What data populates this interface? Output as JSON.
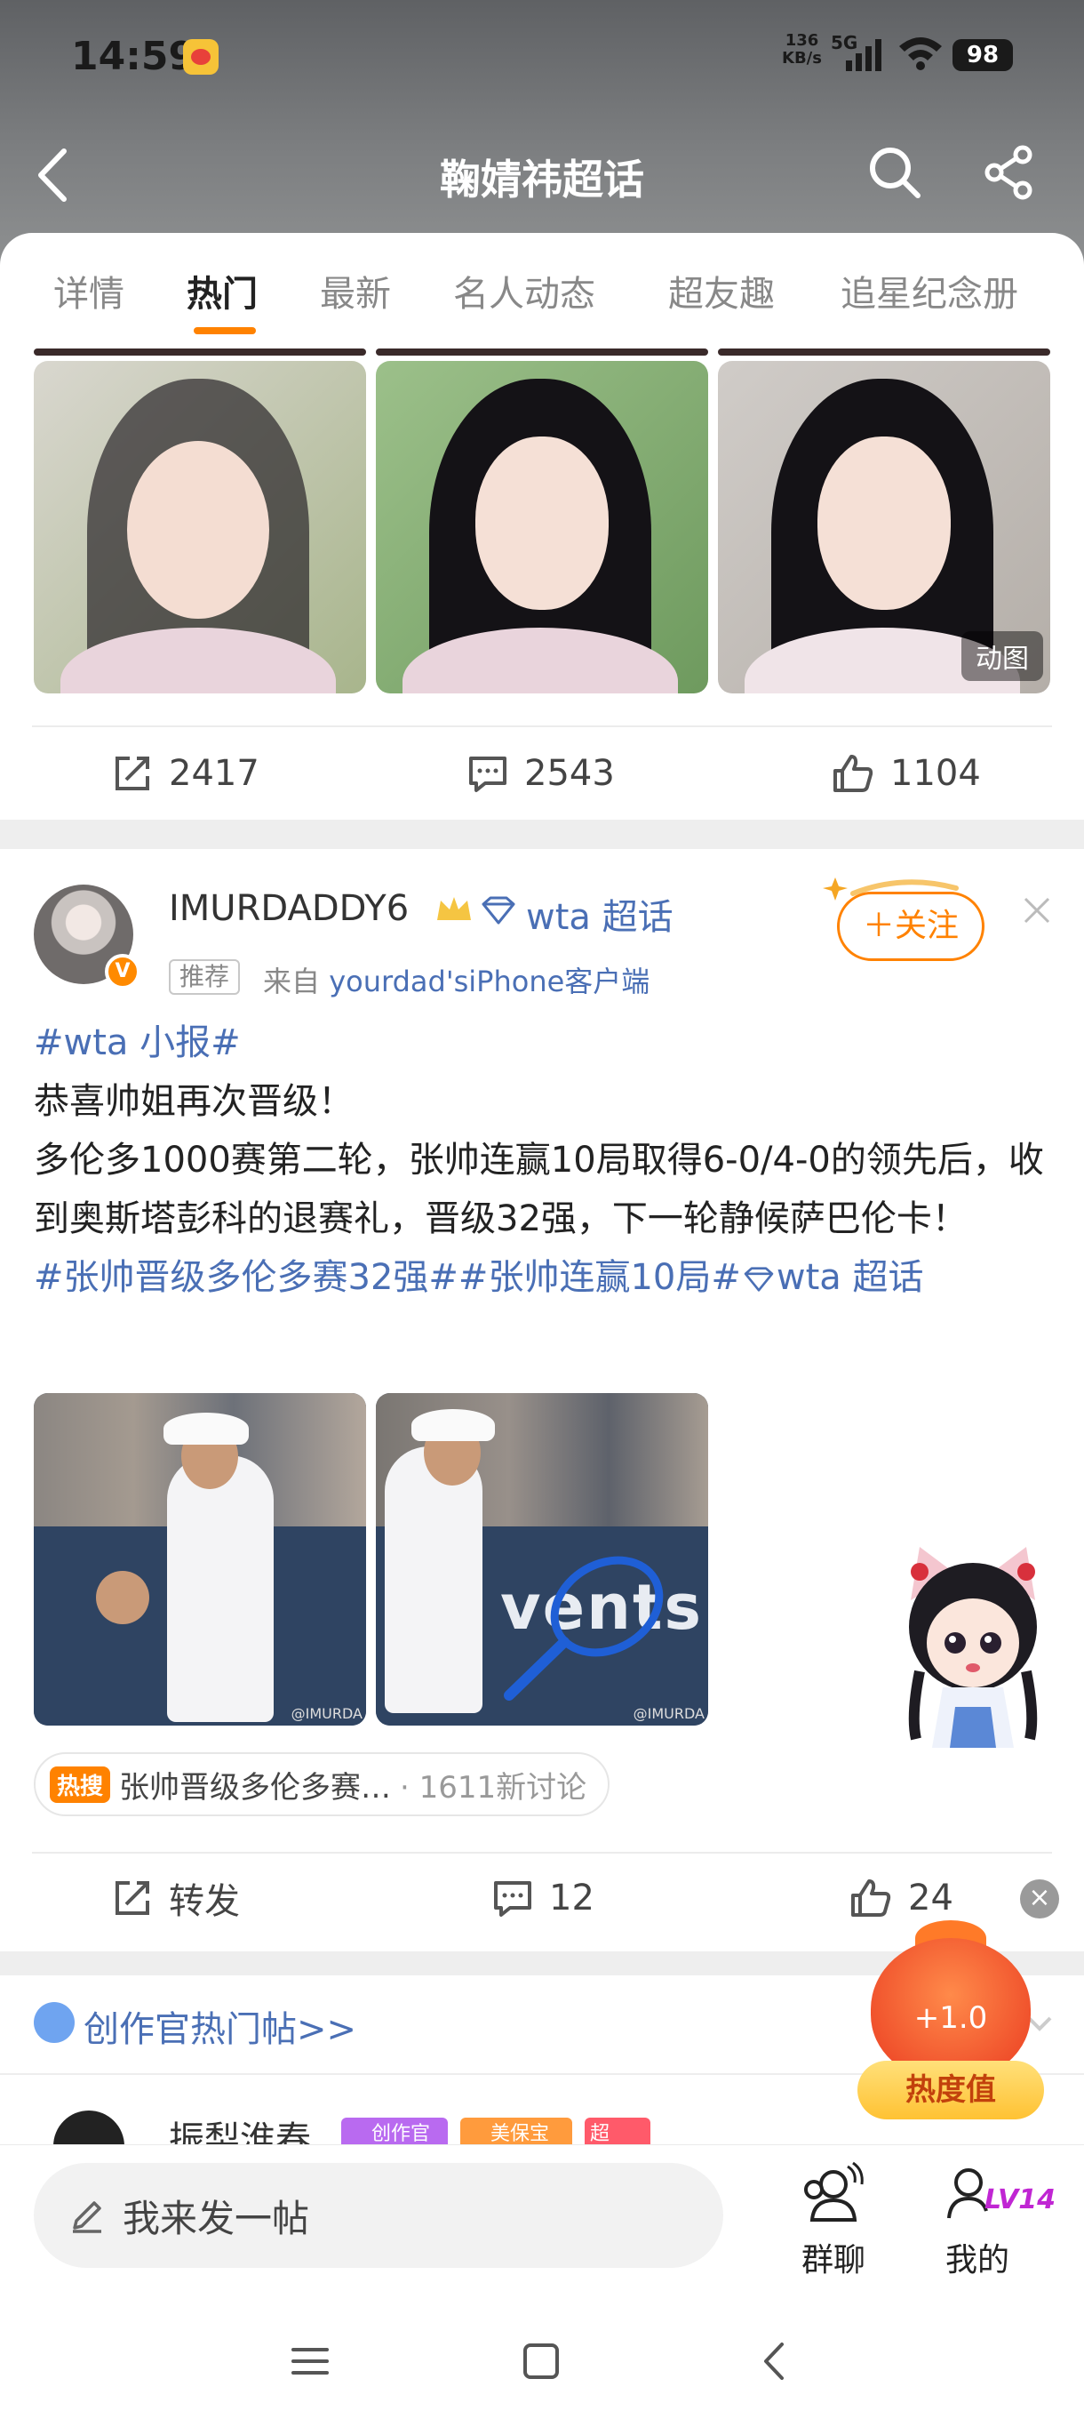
{
  "status_bar": {
    "time": "14:59",
    "net_speed_top": "136",
    "net_speed_bottom": "KB/s",
    "network": "5G",
    "battery": "98"
  },
  "header": {
    "title": "鞠婧祎超话"
  },
  "tabs": [
    {
      "label": "详情",
      "active": false
    },
    {
      "label": "热门",
      "active": true
    },
    {
      "label": "最新",
      "active": false
    },
    {
      "label": "名人动态",
      "active": false
    },
    {
      "label": "超友趣",
      "active": false
    },
    {
      "label": "追星纪念册",
      "active": false
    }
  ],
  "post1": {
    "gif_badge": "动图",
    "repost_count": "2417",
    "comment_count": "2543",
    "like_count": "1104"
  },
  "post2": {
    "username": "IMURDADDY6",
    "topic": "wta 超话",
    "rec_tag": "推荐",
    "source_prefix": "来自 ",
    "source_device": "yourdad'siPhone客户端",
    "follow_label": "＋关注",
    "text_tag": "#wta 小报#",
    "text_line1": "恭喜帅姐再次晋级！",
    "text_body": "多伦多1000赛第二轮，张帅连赢10局取得6-0/4-0的领先后，收到奥斯塔彭科的退赛礼，晋级32强，下一轮静候萨巴伦卡！",
    "hashtags": "#张帅晋级多伦多赛32强##张帅连赢10局#",
    "hashtag_topic": "wta 超话",
    "photo_watermark": "@IMURDA",
    "photo_brand": "vents",
    "hot_tag": "热搜",
    "hot_title": "张帅晋级多伦多赛…",
    "hot_count": "· 1611新讨论",
    "repost_label": "转发",
    "comment_count": "12",
    "like_count": "24"
  },
  "creator_section": {
    "label": "创作官热门帖>>"
  },
  "next_post": {
    "username": "振梨淮春",
    "badge1": "创作官",
    "badge2": "美保宝",
    "badge3": "超LIKE"
  },
  "heat": {
    "value": "+1.0",
    "label": "热度值"
  },
  "bottom_bar": {
    "compose_placeholder": "我来发一帖",
    "group_chat": "群聊",
    "me": "我的",
    "level": "LV14"
  },
  "colors": {
    "accent": "#ff8200",
    "link": "#4a6fb5"
  }
}
